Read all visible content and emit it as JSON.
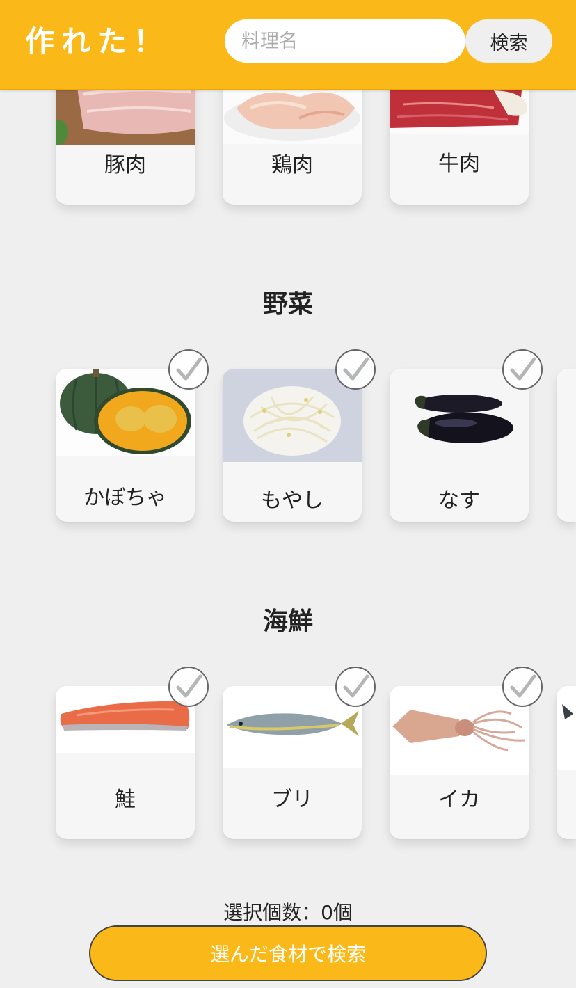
{
  "header": {
    "logo": "作れた！",
    "search_placeholder": "料理名",
    "search_button": "検索"
  },
  "meat": {
    "items": [
      {
        "label": "豚肉",
        "image": "pork-photo"
      },
      {
        "label": "鶏肉",
        "image": "chicken-photo"
      },
      {
        "label": "牛肉",
        "image": "beef-photo"
      }
    ]
  },
  "vegetables": {
    "title": "野菜",
    "items": [
      {
        "label": "かぼちゃ",
        "image": "pumpkin-photo"
      },
      {
        "label": "もやし",
        "image": "bean-sprouts-photo"
      },
      {
        "label": "なす",
        "image": "eggplant-photo"
      }
    ]
  },
  "seafood": {
    "title": "海鮮",
    "items": [
      {
        "label": "鮭",
        "image": "salmon-photo"
      },
      {
        "label": "ブリ",
        "image": "yellowtail-photo"
      },
      {
        "label": "イカ",
        "image": "squid-photo"
      }
    ]
  },
  "footer": {
    "count_text": "選択個数：0個",
    "submit_button": "選んだ食材で検索"
  },
  "colors": {
    "brand": "#fbb819",
    "background": "#efefef",
    "card": "#f7f6f7"
  }
}
